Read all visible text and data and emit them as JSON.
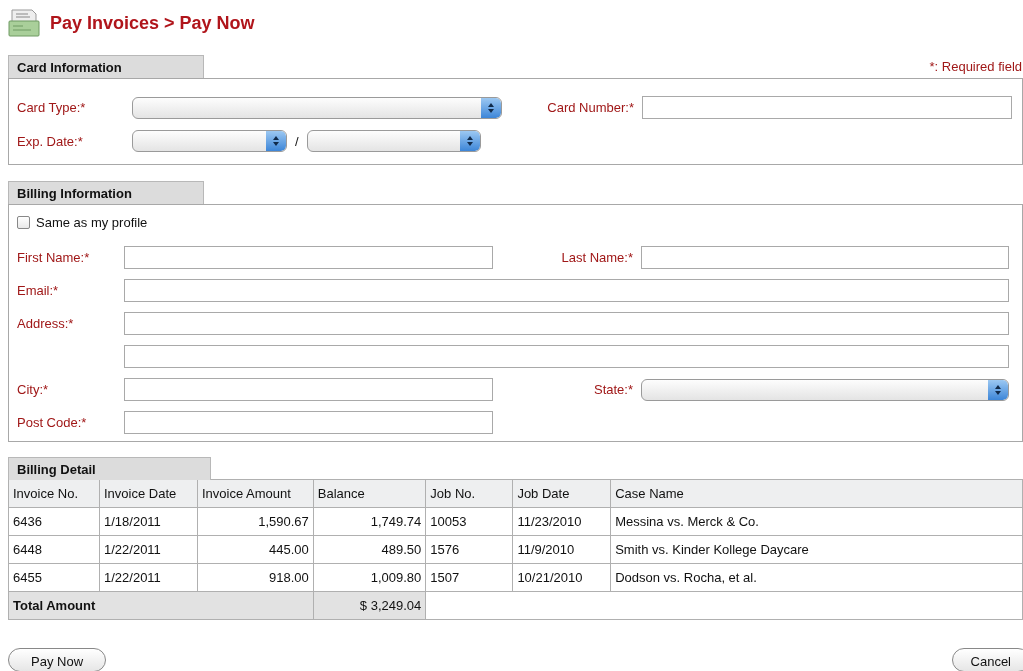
{
  "header": {
    "title": "Pay Invoices > Pay Now"
  },
  "sections": [
    {
      "title": "Card Information",
      "required_note": "*: Required field",
      "rows": [
        [
          {
            "label": "Card Type:*",
            "kind": "select"
          },
          {
            "label": "Card Number:*",
            "kind": "text"
          }
        ],
        [
          {
            "label": "Exp. Date:*",
            "kind": "select-pair",
            "separator": "/"
          }
        ]
      ]
    },
    {
      "title": "Billing Information",
      "checkbox": {
        "label": "Same as my profile",
        "checked": false
      },
      "rows": [
        [
          {
            "label": "First Name:*",
            "kind": "text"
          },
          {
            "label": "Last Name:*",
            "kind": "text"
          }
        ],
        [
          {
            "label": "Email:*",
            "kind": "text"
          }
        ],
        [
          {
            "label": "Address:*",
            "kind": "text"
          }
        ],
        [
          {
            "kind": "text"
          }
        ],
        [
          {
            "label": "City:*",
            "kind": "text"
          },
          {
            "label": "State:*",
            "kind": "select"
          }
        ],
        [
          {
            "label": "Post Code:*",
            "kind": "text-short"
          }
        ]
      ]
    }
  ],
  "billing_detail": {
    "title": "Billing Detail",
    "columns": [
      {
        "label": "Invoice No.",
        "kind": "text"
      },
      {
        "label": "Invoice Date",
        "kind": "text"
      },
      {
        "label": "Invoice Amount",
        "kind": "amount"
      },
      {
        "label": "Balance",
        "kind": "amount"
      },
      {
        "label": "Job No.",
        "kind": "text"
      },
      {
        "label": "Job Date",
        "kind": "text"
      },
      {
        "label": "Case Name",
        "kind": "text"
      }
    ],
    "rows": [
      [
        "6436",
        "1/18/2011",
        "1,590.67",
        "1,749.74",
        "10053",
        "11/23/2010",
        "Messina vs. Merck & Co."
      ],
      [
        "6448",
        "1/22/2011",
        "445.00",
        "489.50",
        "1576",
        "11/9/2010",
        "Smith vs. Kinder Kollege Daycare"
      ],
      [
        "6455",
        "1/22/2011",
        "918.00",
        "1,009.80",
        "1507",
        "10/21/2010",
        "Dodson vs. Rocha, et al."
      ]
    ],
    "total": {
      "label": "Total Amount",
      "value": "$ 3,249.04"
    }
  },
  "buttons": [
    {
      "label": "Pay Now",
      "kind": "submit"
    },
    {
      "label": "Cancel",
      "kind": "cancel"
    }
  ]
}
